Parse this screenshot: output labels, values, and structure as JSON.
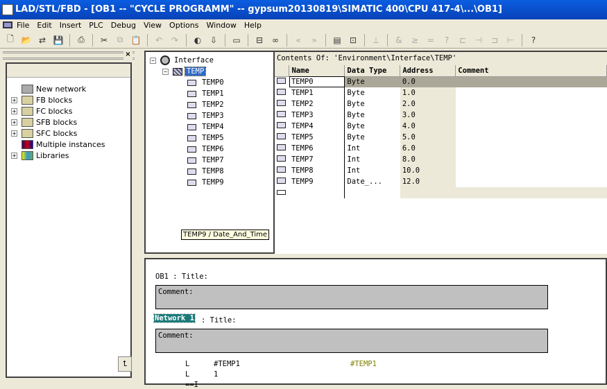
{
  "window": {
    "title": "LAD/STL/FBD  - [OB1 -- \"CYCLE PROGRAMM\" -- gypsum20130819\\SIMATIC 400\\CPU 417-4\\...\\OB1]"
  },
  "menu": [
    "File",
    "Edit",
    "Insert",
    "PLC",
    "Debug",
    "View",
    "Options",
    "Window",
    "Help"
  ],
  "toolbar": {
    "icons": [
      "new-icon",
      "open-icon",
      "accessible-nodes-icon",
      "save-icon",
      "print-icon",
      "cut-icon",
      "copy-icon",
      "paste-icon",
      "undo-icon",
      "redo-icon",
      "monitor-icon",
      "download-icon",
      "overview-icon",
      "network-icon",
      "glasses-icon",
      "prev-error-icon",
      "next-error-icon",
      "program-elements-icon",
      "details-icon",
      "new-network-icon",
      "and-icon",
      "or-icon",
      "assign-icon",
      "unknown-box-icon",
      "branch-open-icon",
      "contact-icon",
      "branch-close-icon",
      "coil-icon",
      "help-icon"
    ]
  },
  "catalog": {
    "items": [
      {
        "label": "New network",
        "expandable": false
      },
      {
        "label": "FB blocks",
        "expandable": true
      },
      {
        "label": "FC blocks",
        "expandable": true
      },
      {
        "label": "SFB blocks",
        "expandable": true
      },
      {
        "label": "SFC blocks",
        "expandable": true
      },
      {
        "label": "Multiple instances",
        "expandable": false
      },
      {
        "label": "Libraries",
        "expandable": true
      }
    ],
    "bottom_button": "⮤"
  },
  "interface_tree": {
    "root": "Interface",
    "node": "TEMP",
    "children": [
      "TEMP0",
      "TEMP1",
      "TEMP2",
      "TEMP3",
      "TEMP4",
      "TEMP5",
      "TEMP6",
      "TEMP7",
      "TEMP8",
      "TEMP9"
    ],
    "tooltip": "TEMP9 / Date_And_Time"
  },
  "table": {
    "contents_label": "Contents Of:  'Environment\\Interface\\TEMP'",
    "columns": [
      "Name",
      "Data Type",
      "Address",
      "Comment"
    ],
    "rows": [
      {
        "name": "TEMP0",
        "type": "Byte",
        "address": "0.0",
        "comment": ""
      },
      {
        "name": "TEMP1",
        "type": "Byte",
        "address": "1.0",
        "comment": ""
      },
      {
        "name": "TEMP2",
        "type": "Byte",
        "address": "2.0",
        "comment": ""
      },
      {
        "name": "TEMP3",
        "type": "Byte",
        "address": "3.0",
        "comment": ""
      },
      {
        "name": "TEMP4",
        "type": "Byte",
        "address": "4.0",
        "comment": ""
      },
      {
        "name": "TEMP5",
        "type": "Byte",
        "address": "5.0",
        "comment": ""
      },
      {
        "name": "TEMP6",
        "type": "Int",
        "address": "6.0",
        "comment": ""
      },
      {
        "name": "TEMP7",
        "type": "Int",
        "address": "8.0",
        "comment": ""
      },
      {
        "name": "TEMP8",
        "type": "Int",
        "address": "10.0",
        "comment": ""
      },
      {
        "name": "TEMP9",
        "type": "Date_...",
        "address": "12.0",
        "comment": ""
      }
    ]
  },
  "editor": {
    "block_title": "OB1 : Title:",
    "block_comment": "Comment:",
    "network_label": "Network 1",
    "network_title": ": Title:",
    "network_comment": "Comment:",
    "code": [
      {
        "op": "L",
        "arg": "#TEMP1",
        "status": "#TEMP1"
      },
      {
        "op": "L",
        "arg": "1",
        "status": ""
      },
      {
        "op": "==I",
        "arg": "",
        "status": ""
      }
    ],
    "status_color": "#808000"
  }
}
